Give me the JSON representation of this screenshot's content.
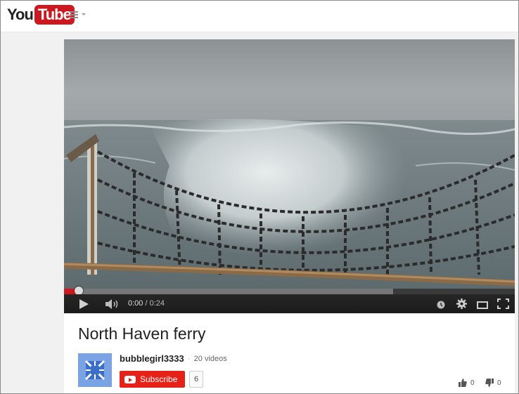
{
  "masthead": {
    "logo_you": "You",
    "logo_tube": "Tube"
  },
  "player": {
    "current_time": "0:00",
    "separator": " / ",
    "duration": "0:24",
    "played_fraction": 0.03,
    "loaded_fraction": 0.73
  },
  "video": {
    "title": "North Haven ferry"
  },
  "channel": {
    "name": "bubblegirl3333",
    "separator": "·",
    "video_count": "20 videos"
  },
  "subscribe": {
    "label": "Subscribe",
    "count": "6"
  },
  "ratings": {
    "likes": "0",
    "dislikes": "0"
  },
  "colors": {
    "brand_red": "#cc181e",
    "subscribe_red": "#e62117",
    "page_bg": "#f1f1f1",
    "avatar_blue": "#7aa3e5"
  },
  "icons": [
    "guide-menu-icon",
    "play-icon",
    "volume-icon",
    "watch-later-icon",
    "settings-gear-icon",
    "theater-mode-icon",
    "fullscreen-icon",
    "youtube-play-icon",
    "thumbs-up-icon",
    "thumbs-down-icon"
  ]
}
